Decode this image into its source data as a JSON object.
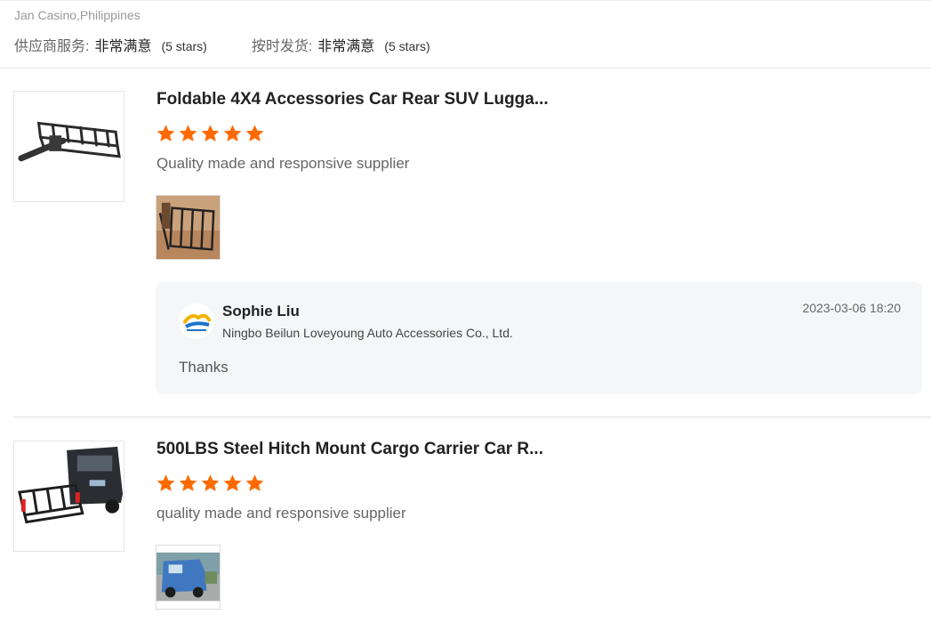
{
  "header": {
    "buyer_location": "Jan Casino,Philippines",
    "ratings": [
      {
        "label": "供应商服务:",
        "value": "非常满意",
        "stars": "(5 stars)"
      },
      {
        "label": "按时发货:",
        "value": "非常满意",
        "stars": "(5 stars)"
      }
    ]
  },
  "reviews": [
    {
      "title": "Foldable 4X4 Accessories Car Rear SUV Lugga...",
      "rating": 5,
      "comment": "Quality made and responsive supplier",
      "reply": {
        "name": "Sophie Liu",
        "company": "Ningbo Beilun Loveyoung Auto Accessories Co., Ltd.",
        "date": "2023-03-06 18:20",
        "message": "Thanks"
      }
    },
    {
      "title": "500LBS Steel Hitch Mount Cargo Carrier Car R...",
      "rating": 5,
      "comment": "quality made and responsive supplier"
    }
  ],
  "colors": {
    "star": "#ff6a00",
    "reply_bg": "#f5f6f8"
  },
  "icons": {
    "star": "star-icon",
    "supplier_logo": "loveyoung-logo"
  }
}
